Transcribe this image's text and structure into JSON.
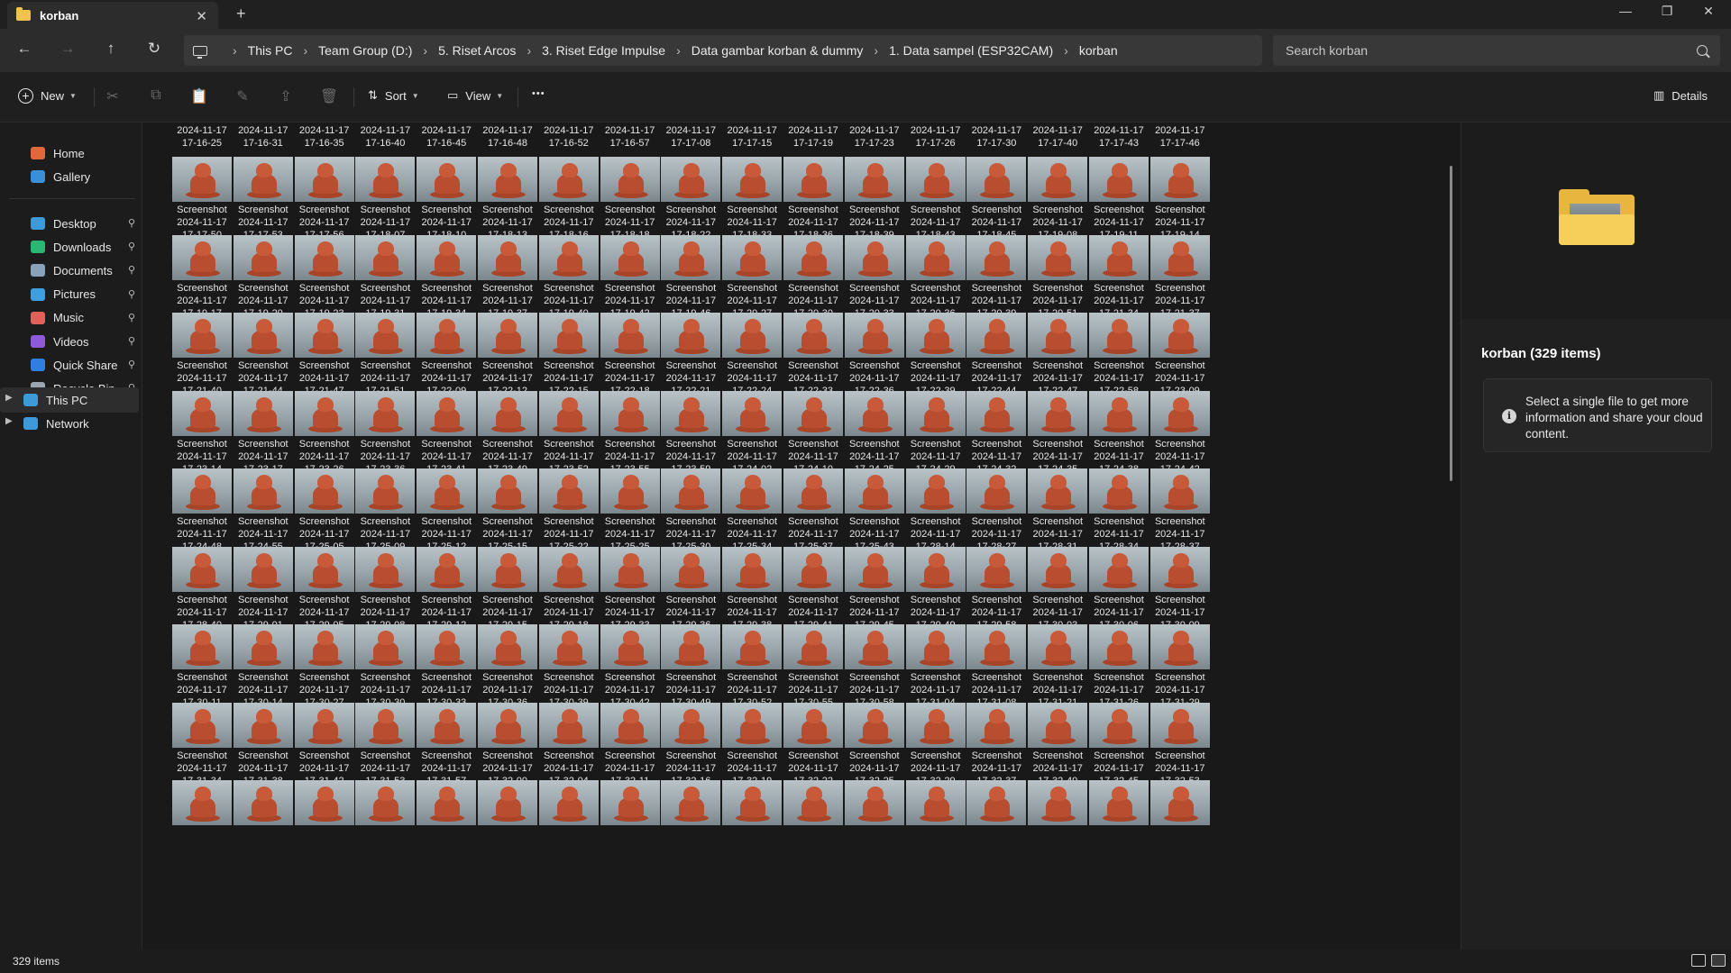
{
  "window": {
    "tab_title": "korban",
    "tab_close": "✕",
    "tab_add": "+",
    "minimize": "—",
    "maximize": "❐",
    "close": "✕"
  },
  "nav": {
    "back": "←",
    "forward": "→",
    "up": "↑",
    "refresh": "↻"
  },
  "breadcrumb": [
    "This PC",
    "Team Group (D:)",
    "5. Riset Arcos",
    "3. Riset Edge Impulse",
    "Data gambar korban & dummy",
    "1. Data sampel (ESP32CAM)",
    "korban"
  ],
  "search": {
    "placeholder": "Search korban",
    "value": ""
  },
  "toolbar": {
    "new_label": "New",
    "sort_label": "Sort",
    "view_label": "View",
    "more": "•••",
    "details_label": "Details",
    "icons": [
      "cut-icon",
      "copy-icon",
      "paste-icon",
      "rename-icon",
      "share-icon",
      "delete-icon"
    ]
  },
  "sidebar": {
    "top": [
      {
        "label": "Home",
        "icon": "home-icon",
        "color": "#e0683a"
      },
      {
        "label": "Gallery",
        "icon": "gallery-icon",
        "color": "#3a8fd6"
      }
    ],
    "quick": [
      {
        "label": "Desktop",
        "icon": "desktop-icon",
        "color": "#3c9ad8"
      },
      {
        "label": "Downloads",
        "icon": "downloads-icon",
        "color": "#2bb673"
      },
      {
        "label": "Documents",
        "icon": "documents-icon",
        "color": "#8aa2b8"
      },
      {
        "label": "Pictures",
        "icon": "pictures-icon",
        "color": "#3d9ee0"
      },
      {
        "label": "Music",
        "icon": "music-icon",
        "color": "#e2605a"
      },
      {
        "label": "Videos",
        "icon": "videos-icon",
        "color": "#8e5ad8"
      },
      {
        "label": "Quick Share",
        "icon": "quick-share-icon",
        "color": "#2f7fe0"
      },
      {
        "label": "Recycle Bin",
        "icon": "recycle-bin-icon",
        "color": "#9aa7b2"
      }
    ],
    "drives": [
      {
        "label": "This PC",
        "icon": "pc-icon",
        "color": "#3c9ad8",
        "selected": true
      },
      {
        "label": "Network",
        "icon": "network-icon",
        "color": "#3c9ad8",
        "selected": false
      }
    ],
    "pin_glyph": "📌"
  },
  "files": {
    "name_prefix": "Screenshot",
    "date": "2024-11-17",
    "partial_top_row_times": [
      "17-16-25",
      "17-16-31",
      "17-16-35",
      "17-16-40",
      "17-16-45",
      "17-16-48",
      "17-16-52",
      "17-16-57",
      "17-17-08",
      "17-17-15",
      "17-17-19",
      "17-17-23",
      "17-17-26",
      "17-17-30",
      "17-17-40",
      "17-17-43",
      "17-17-46"
    ],
    "rows": [
      [
        "17-17-50",
        "17-17-53",
        "17-17-56",
        "17-18-07",
        "17-18-10",
        "17-18-13",
        "17-18-16",
        "17-18-18",
        "17-18-22",
        "17-18-33",
        "17-18-36",
        "17-18-39",
        "17-18-43",
        "17-18-45",
        "17-19-08",
        "17-19-11",
        "17-19-14"
      ],
      [
        "17-19-17",
        "17-19-20",
        "17-19-23",
        "17-19-31",
        "17-19-34",
        "17-19-37",
        "17-19-40",
        "17-19-42",
        "17-19-46",
        "17-20-27",
        "17-20-30",
        "17-20-33",
        "17-20-36",
        "17-20-39",
        "17-20-51",
        "17-21-34",
        "17-21-37"
      ],
      [
        "17-21-40",
        "17-21-44",
        "17-21-47",
        "17-21-51",
        "17-22-09",
        "17-22-12",
        "17-22-15",
        "17-22-18",
        "17-22-21",
        "17-22-24",
        "17-22-33",
        "17-22-36",
        "17-22-39",
        "17-22-44",
        "17-22-47",
        "17-22-58",
        "17-23-09"
      ],
      [
        "17-23-14",
        "17-23-17",
        "17-23-26",
        "17-23-36",
        "17-23-41",
        "17-23-49",
        "17-23-52",
        "17-23-55",
        "17-23-59",
        "17-24-02",
        "17-24-10",
        "17-24-25",
        "17-24-29",
        "17-24-32",
        "17-24-35",
        "17-24-38",
        "17-24-42"
      ],
      [
        "17-24-48",
        "17-24-55",
        "17-25-05",
        "17-25-09",
        "17-25-12",
        "17-25-15",
        "17-25-22",
        "17-25-25",
        "17-25-30",
        "17-25-34",
        "17-25-37",
        "17-25-43",
        "17-28-14",
        "17-28-27",
        "17-28-31",
        "17-28-34",
        "17-28-37"
      ],
      [
        "17-28-40",
        "17-29-01",
        "17-29-05",
        "17-29-08",
        "17-29-12",
        "17-29-15",
        "17-29-18",
        "17-29-33",
        "17-29-36",
        "17-29-38",
        "17-29-41",
        "17-29-45",
        "17-29-49",
        "17-29-58",
        "17-30-03",
        "17-30-06",
        "17-30-09"
      ],
      [
        "17-30-11",
        "17-30-14",
        "17-30-27",
        "17-30-30",
        "17-30-33",
        "17-30-36",
        "17-30-39",
        "17-30-42",
        "17-30-49",
        "17-30-52",
        "17-30-55",
        "17-30-58",
        "17-31-04",
        "17-31-08",
        "17-31-21",
        "17-31-26",
        "17-31-29"
      ],
      [
        "17-31-34",
        "17-31-38",
        "17-31-42",
        "17-31-53",
        "17-31-57",
        "17-32-00",
        "17-32-04",
        "17-32-11",
        "17-32-16",
        "17-32-19",
        "17-32-22",
        "17-32-25",
        "17-32-29",
        "17-32-37",
        "17-32-40",
        "17-32-45",
        "17-32-53"
      ]
    ]
  },
  "details": {
    "title": "korban (329 items)",
    "info": "Select a single file to get more information and share your cloud content.",
    "info_glyph": "i"
  },
  "status": {
    "count": "329 items"
  }
}
